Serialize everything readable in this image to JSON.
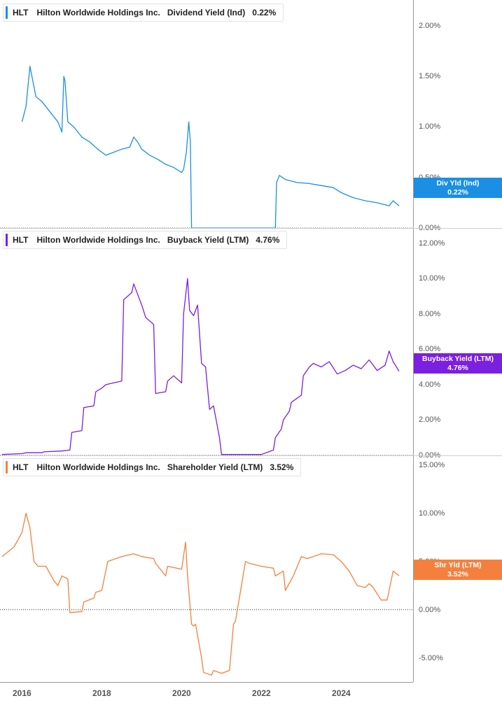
{
  "chart_data": [
    {
      "type": "line",
      "ticker": "HLT",
      "company": "Hilton Worldwide Holdings Inc.",
      "metric": "Dividend Yield (Ind)",
      "current_value": "0.22%",
      "badge": {
        "label": "Div Yld (Ind)",
        "value": "0.22%"
      },
      "color": "#1a8fe3",
      "ylim": [
        0,
        2.2
      ],
      "yticks": [
        "0.00%",
        "0.50%",
        "1.00%",
        "1.50%",
        "2.00%"
      ],
      "ytick_values": [
        0,
        0.5,
        1.0,
        1.5,
        2.0
      ],
      "zero_line": "dotted",
      "series": [
        {
          "x": [
            2016.0,
            2016.1,
            2016.2,
            2016.35,
            2016.5,
            2016.7,
            2016.9,
            2017.0,
            2017.05,
            2017.08,
            2017.15,
            2017.3,
            2017.5,
            2017.7,
            2017.9,
            2018.1,
            2018.3,
            2018.5,
            2018.7,
            2018.8,
            2018.9,
            2019.0,
            2019.2,
            2019.4,
            2019.6,
            2019.8,
            2020.0,
            2020.05,
            2020.12,
            2020.18,
            2020.22,
            2020.25,
            2020.28,
            2020.5,
            2021.0,
            2021.5,
            2022.0,
            2022.35,
            2022.38,
            2022.45,
            2022.6,
            2022.9,
            2023.2,
            2023.5,
            2023.8,
            2024.0,
            2024.3,
            2024.6,
            2024.9,
            2025.1,
            2025.2,
            2025.3,
            2025.45
          ],
          "y": [
            1.05,
            1.2,
            1.6,
            1.3,
            1.25,
            1.15,
            1.05,
            0.95,
            1.5,
            1.45,
            1.05,
            1.0,
            0.9,
            0.85,
            0.78,
            0.72,
            0.75,
            0.78,
            0.8,
            0.9,
            0.85,
            0.78,
            0.72,
            0.68,
            0.63,
            0.6,
            0.55,
            0.58,
            0.75,
            1.05,
            0.85,
            0.0,
            0.0,
            0.0,
            0.0,
            0.0,
            0.0,
            0.0,
            0.45,
            0.52,
            0.48,
            0.45,
            0.44,
            0.42,
            0.4,
            0.35,
            0.3,
            0.27,
            0.25,
            0.23,
            0.22,
            0.27,
            0.22
          ]
        }
      ]
    },
    {
      "type": "line",
      "ticker": "HLT",
      "company": "Hilton Worldwide Holdings Inc.",
      "metric": "Buyback Yield (LTM)",
      "current_value": "4.76%",
      "badge": {
        "label": "Buyback Yield (LTM)",
        "value": "4.76%"
      },
      "color": "#7b1fe0",
      "ylim": [
        0,
        12.5
      ],
      "yticks": [
        "0.00%",
        "2.00%",
        "4.00%",
        "6.00%",
        "8.00%",
        "10.00%",
        "12.00%"
      ],
      "ytick_values": [
        0,
        2,
        4,
        6,
        8,
        10,
        12
      ],
      "zero_line": "dotted",
      "series": [
        {
          "x": [
            2015.5,
            2016.0,
            2016.1,
            2016.5,
            2016.55,
            2017.0,
            2017.2,
            2017.25,
            2017.5,
            2017.55,
            2017.8,
            2017.85,
            2018.0,
            2018.1,
            2018.5,
            2018.55,
            2018.75,
            2018.8,
            2019.0,
            2019.1,
            2019.3,
            2019.35,
            2019.6,
            2019.65,
            2019.8,
            2020.0,
            2020.05,
            2020.15,
            2020.2,
            2020.3,
            2020.4,
            2020.5,
            2020.6,
            2020.7,
            2020.8,
            2020.95,
            2021.0,
            2021.1,
            2021.15,
            2021.5,
            2022.0,
            2022.3,
            2022.35,
            2022.5,
            2022.55,
            2022.7,
            2022.75,
            2023.0,
            2023.05,
            2023.2,
            2023.3,
            2023.5,
            2023.7,
            2023.9,
            2024.1,
            2024.3,
            2024.5,
            2024.7,
            2024.9,
            2025.1,
            2025.2,
            2025.3,
            2025.45
          ],
          "y": [
            0.05,
            0.1,
            0.15,
            0.15,
            0.2,
            0.25,
            0.3,
            1.3,
            1.4,
            2.7,
            2.8,
            3.6,
            3.8,
            4.0,
            4.2,
            8.8,
            9.2,
            9.7,
            8.5,
            7.8,
            7.4,
            3.5,
            3.6,
            4.2,
            4.5,
            4.1,
            8.0,
            10.0,
            8.2,
            7.9,
            8.5,
            5.2,
            5.0,
            2.6,
            2.8,
            1.0,
            0.05,
            0.05,
            0.05,
            0.05,
            0.05,
            0.3,
            1.0,
            1.5,
            2.0,
            2.5,
            3.0,
            3.4,
            4.5,
            5.0,
            5.2,
            5.0,
            5.3,
            4.6,
            4.8,
            5.1,
            4.9,
            5.4,
            4.8,
            5.1,
            5.9,
            5.3,
            4.76
          ]
        }
      ]
    },
    {
      "type": "line",
      "ticker": "HLT",
      "company": "Hilton Worldwide Holdings Inc.",
      "metric": "Shareholder Yield (LTM)",
      "current_value": "3.52%",
      "badge": {
        "label": "Shr Yld (LTM)",
        "value": "3.52%"
      },
      "color": "#f5803e",
      "ylim": [
        -7.5,
        15.2
      ],
      "yticks": [
        "-5.00%",
        "0.00%",
        "5.00%",
        "10.00%",
        "15.00%"
      ],
      "ytick_values": [
        -5,
        0,
        5,
        10,
        15
      ],
      "zero_line": "dotted",
      "series": [
        {
          "x": [
            2015.5,
            2015.8,
            2016.0,
            2016.1,
            2016.2,
            2016.3,
            2016.4,
            2016.6,
            2016.8,
            2016.9,
            2017.0,
            2017.15,
            2017.2,
            2017.5,
            2017.55,
            2017.8,
            2017.85,
            2018.0,
            2018.15,
            2018.5,
            2018.8,
            2019.0,
            2019.3,
            2019.35,
            2019.6,
            2019.65,
            2020.0,
            2020.1,
            2020.15,
            2020.25,
            2020.3,
            2020.35,
            2020.5,
            2020.55,
            2020.75,
            2020.8,
            2021.0,
            2021.2,
            2021.3,
            2021.35,
            2021.6,
            2021.7,
            2022.0,
            2022.3,
            2022.35,
            2022.55,
            2022.6,
            2022.8,
            2023.0,
            2023.15,
            2023.3,
            2023.5,
            2023.8,
            2024.0,
            2024.2,
            2024.4,
            2024.6,
            2024.7,
            2024.8,
            2025.0,
            2025.15,
            2025.2,
            2025.3,
            2025.45
          ],
          "y": [
            5.5,
            6.5,
            8.0,
            10.0,
            8.5,
            5.0,
            4.5,
            4.5,
            3.0,
            2.5,
            3.5,
            3.2,
            -0.3,
            -0.2,
            0.8,
            1.2,
            1.8,
            2.0,
            5.0,
            5.5,
            5.8,
            5.5,
            5.3,
            4.8,
            3.5,
            4.5,
            4.2,
            7.0,
            3.5,
            -1.5,
            -1.7,
            -1.5,
            -5.0,
            -6.5,
            -6.8,
            -6.3,
            -6.6,
            -6.3,
            -1.5,
            -1.2,
            5.0,
            4.8,
            4.5,
            4.3,
            3.5,
            4.0,
            2.0,
            3.5,
            5.5,
            5.3,
            5.5,
            5.8,
            5.7,
            5.0,
            4.0,
            2.5,
            2.3,
            2.7,
            2.3,
            1.0,
            1.0,
            2.0,
            4.0,
            3.52
          ]
        }
      ]
    }
  ],
  "x_axis": {
    "labels": [
      "2016",
      "2018",
      "2020",
      "2022",
      "2024"
    ],
    "values": [
      2016,
      2018,
      2020,
      2022,
      2024
    ],
    "range": [
      2015.45,
      2025.8
    ]
  }
}
